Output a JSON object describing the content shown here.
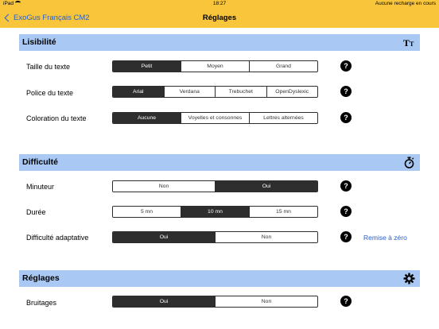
{
  "status_bar": {
    "device": "iPad",
    "time": "18:27",
    "charging_text": "Aucune recharge en cours"
  },
  "nav": {
    "back_label": "ExoGus Français CM2",
    "title": "Réglages"
  },
  "sections": {
    "lisibilite": {
      "title": "Lisibilité",
      "icon": "text-size-icon",
      "icon_text": "TT",
      "rows": {
        "taille": {
          "label": "Taille du texte",
          "options": [
            "Petit",
            "Moyen",
            "Grand"
          ],
          "selected": "Petit"
        },
        "police": {
          "label": "Police du texte",
          "options": [
            "Arial",
            "Verdana",
            "Trebuchet",
            "OpenDyslexic"
          ],
          "selected": "Arial"
        },
        "coloration": {
          "label": "Coloration du texte",
          "options": [
            "Aucune",
            "Voyelles et consonnes",
            "Lettres alternées"
          ],
          "selected": "Aucune"
        }
      }
    },
    "difficulte": {
      "title": "Difficulté",
      "icon": "stopwatch-icon",
      "rows": {
        "minuteur": {
          "label": "Minuteur",
          "options": [
            "Non",
            "Oui"
          ],
          "selected": "Oui"
        },
        "duree": {
          "label": "Durée",
          "options": [
            "5 mn",
            "10 mn",
            "15 mn"
          ],
          "selected": "10 mn"
        },
        "adaptative": {
          "label": "Difficulté adaptative",
          "options": [
            "Oui",
            "Non"
          ],
          "selected": "Oui",
          "reset_label": "Remise à zéro"
        }
      }
    },
    "reglages": {
      "title": "Réglages",
      "icon": "gear-icon",
      "rows": {
        "bruitages": {
          "label": "Bruitages",
          "options": [
            "Oui",
            "Non"
          ],
          "selected": "Oui"
        }
      }
    }
  },
  "help_symbol": "?"
}
